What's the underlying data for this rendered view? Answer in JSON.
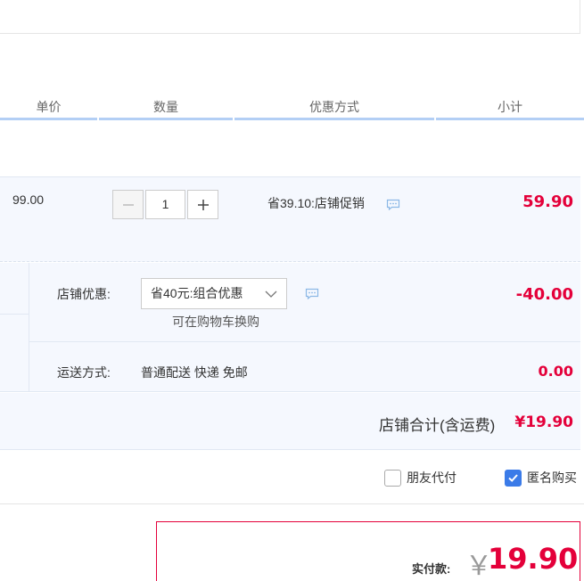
{
  "columns": {
    "price": "单价",
    "quantity": "数量",
    "promo": "优惠方式",
    "subtotal": "小计"
  },
  "item": {
    "unit_price": "99.00",
    "quantity": "1",
    "promo_text": "省39.10:店铺促销",
    "subtotal": "59.90"
  },
  "shop": {
    "discount_label": "店铺优惠:",
    "discount_selected": "省40元:组合优惠",
    "discount_note": "可在购物车换购",
    "discount_amount": "-40.00",
    "shipping_label": "运送方式:",
    "shipping_value": "普通配送 快递 免邮",
    "shipping_amount": "0.00",
    "total_label": "店铺合计(含运费)",
    "total_amount": "¥19.90"
  },
  "options": {
    "friend_pay": "朋友代付",
    "friend_pay_checked": false,
    "anonymous": "匿名购买",
    "anonymous_checked": true
  },
  "payment": {
    "label": "实付款:",
    "currency": "￥",
    "amount": "19.90"
  },
  "colors": {
    "accent_red": "#e4003a",
    "header_underline": "#b3cff5",
    "row_bg": "#f5f8fe",
    "checkbox_blue": "#3b7be8"
  },
  "icons": [
    "minus-icon",
    "plus-icon",
    "chat-bubble-icon",
    "chevron-down-icon",
    "checkmark-icon"
  ]
}
